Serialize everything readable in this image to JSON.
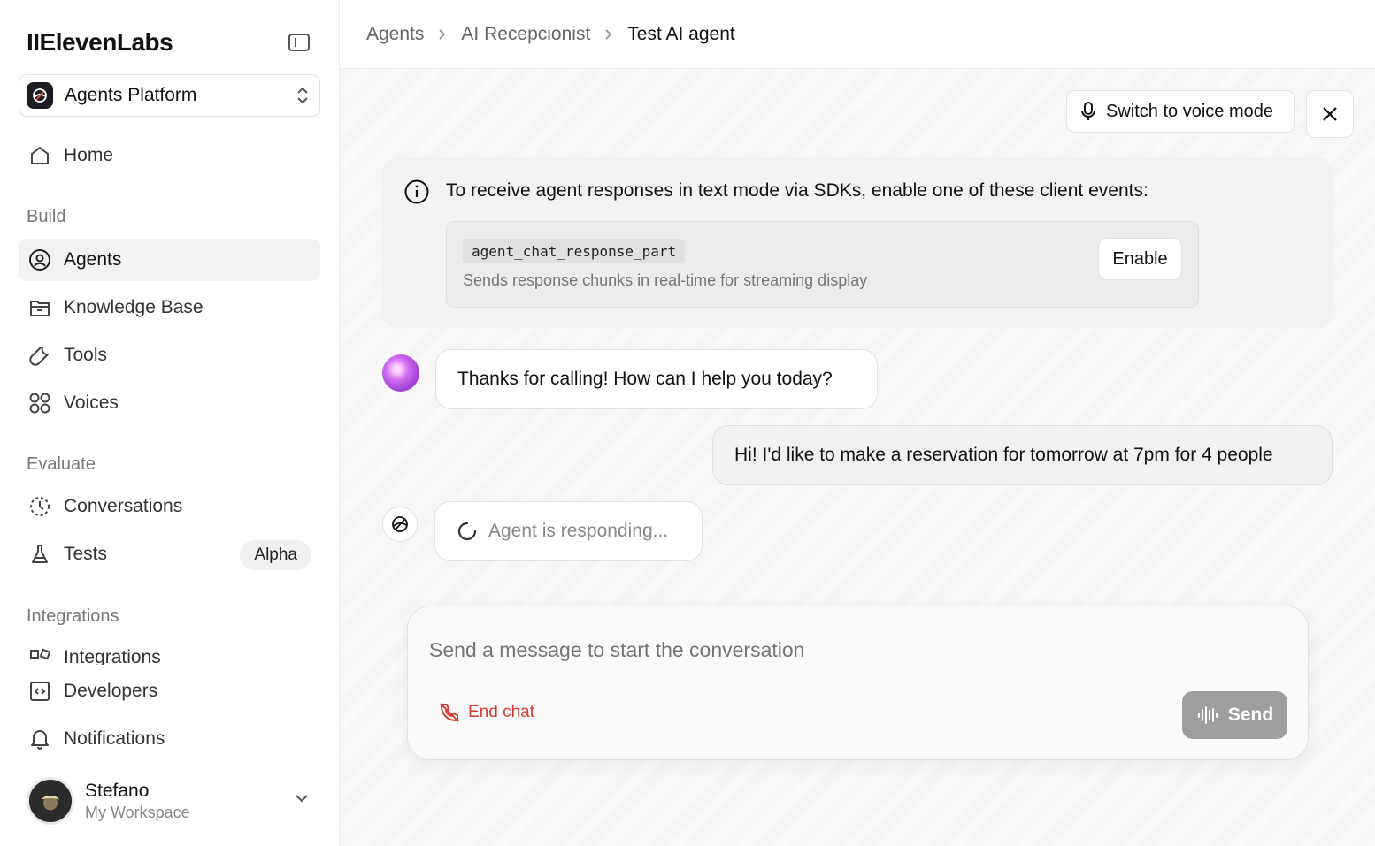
{
  "app": {
    "logo": "IIElevenLabs",
    "platform": "Agents Platform"
  },
  "sidebar": {
    "home": "Home",
    "build_label": "Build",
    "build_items": [
      "Agents",
      "Knowledge Base",
      "Tools",
      "Voices"
    ],
    "evaluate_label": "Evaluate",
    "evaluate_items": [
      "Conversations",
      "Tests"
    ],
    "tests_badge": "Alpha",
    "integrations_label": "Integrations",
    "integrations_item": "Integrations",
    "developers": "Developers",
    "notifications": "Notifications",
    "active_item": "Agents"
  },
  "user": {
    "name": "Stefano",
    "workspace": "My Workspace"
  },
  "breadcrumb": [
    "Agents",
    "AI Recepcionist",
    "Test AI agent"
  ],
  "header": {
    "voice_mode_label": "Switch to voice mode"
  },
  "info": {
    "message": "To receive agent responses in text mode via SDKs, enable one of these client events:",
    "event_code": "agent_chat_response_part",
    "event_description": "Sends response chunks in real-time for streaming display",
    "enable_label": "Enable"
  },
  "chat": {
    "agent_message": "Thanks for calling! How can I help you today?",
    "user_message": "Hi! I'd like to make a reservation for tomorrow at 7pm for 4 people",
    "status": "Agent is responding..."
  },
  "composer": {
    "placeholder": "Send a message to start the conversation",
    "end_chat_label": "End chat",
    "send_label": "Send"
  },
  "colors": {
    "end_chat": "#d33b2f",
    "send_disabled": "#9e9e9e",
    "active_nav": "#f2f2f2"
  }
}
